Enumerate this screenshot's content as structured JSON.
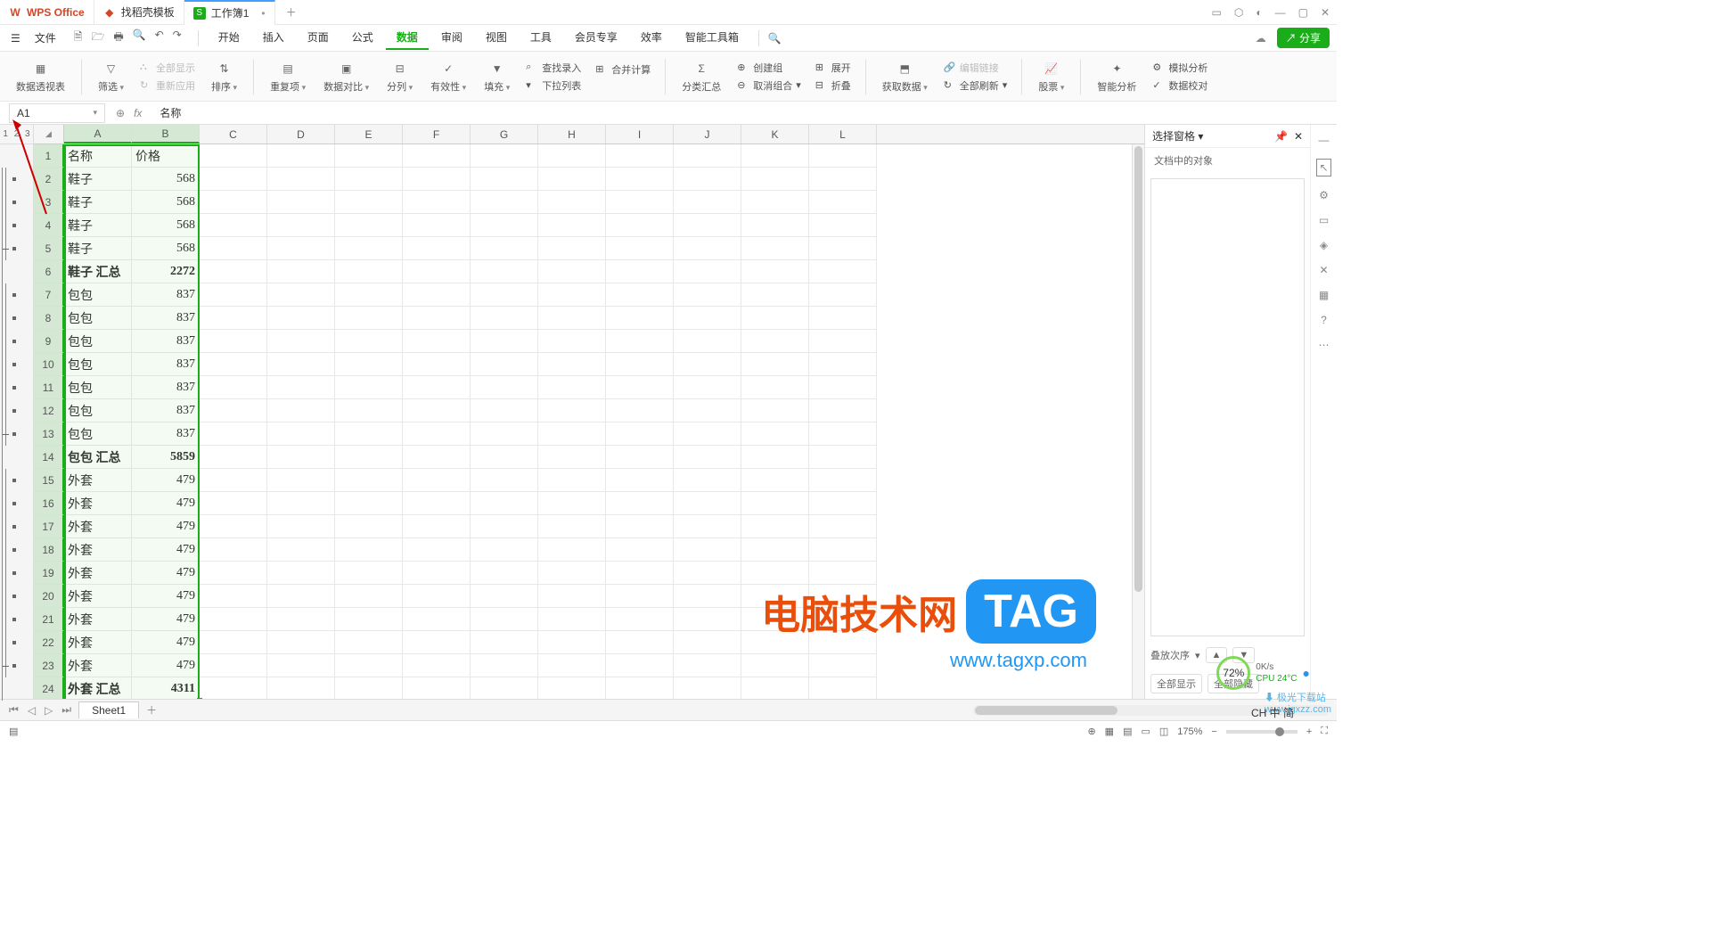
{
  "titlebar": {
    "wps": "WPS Office",
    "tab1": "找稻壳模板",
    "tab2": "工作簿1"
  },
  "menubar": {
    "file": "文件",
    "tabs": [
      "开始",
      "插入",
      "页面",
      "公式",
      "数据",
      "审阅",
      "视图",
      "工具",
      "会员专享",
      "效率",
      "智能工具箱"
    ],
    "active_index": 4,
    "share": "分享"
  },
  "ribbon": {
    "pivot": "数据透视表",
    "filter": "筛选",
    "show_all": "全部显示",
    "reapply": "重新应用",
    "sort": "排序",
    "dup": "重复项",
    "compare": "数据对比",
    "split": "分列",
    "valid": "有效性",
    "fill": "填充",
    "lookup": "查找录入",
    "consol": "合并计算",
    "dropdown": "下拉列表",
    "subtotal": "分类汇总",
    "group": "创建组",
    "ungroup": "取消组合",
    "expand": "展开",
    "collapse": "折叠",
    "getdata": "获取数据",
    "editlink": "编辑链接",
    "refresh": "全部刷新",
    "stock": "股票",
    "analysis": "智能分析",
    "whatif": "模拟分析",
    "datacheck": "数据校对"
  },
  "formulabar": {
    "namebox": "A1",
    "content": "名称"
  },
  "columns": [
    "A",
    "B",
    "C",
    "D",
    "E",
    "F",
    "G",
    "H",
    "I",
    "J",
    "K",
    "L"
  ],
  "outline_levels": [
    "1",
    "2",
    "3"
  ],
  "rows": [
    {
      "n": 1,
      "a": "名称",
      "b": "价格",
      "bold": false,
      "num": false
    },
    {
      "n": 2,
      "a": "鞋子",
      "b": "568",
      "num": true
    },
    {
      "n": 3,
      "a": "鞋子",
      "b": "568",
      "num": true
    },
    {
      "n": 4,
      "a": "鞋子",
      "b": "568",
      "num": true
    },
    {
      "n": 5,
      "a": "鞋子",
      "b": "568",
      "num": true
    },
    {
      "n": 6,
      "a": "鞋子  汇总",
      "b": "2272",
      "num": true,
      "bold": true
    },
    {
      "n": 7,
      "a": "包包",
      "b": "837",
      "num": true
    },
    {
      "n": 8,
      "a": "包包",
      "b": "837",
      "num": true
    },
    {
      "n": 9,
      "a": "包包",
      "b": "837",
      "num": true
    },
    {
      "n": 10,
      "a": "包包",
      "b": "837",
      "num": true
    },
    {
      "n": 11,
      "a": "包包",
      "b": "837",
      "num": true
    },
    {
      "n": 12,
      "a": "包包",
      "b": "837",
      "num": true
    },
    {
      "n": 13,
      "a": "包包",
      "b": "837",
      "num": true
    },
    {
      "n": 14,
      "a": "包包  汇总",
      "b": "5859",
      "num": true,
      "bold": true
    },
    {
      "n": 15,
      "a": "外套",
      "b": "479",
      "num": true
    },
    {
      "n": 16,
      "a": "外套",
      "b": "479",
      "num": true
    },
    {
      "n": 17,
      "a": "外套",
      "b": "479",
      "num": true
    },
    {
      "n": 18,
      "a": "外套",
      "b": "479",
      "num": true
    },
    {
      "n": 19,
      "a": "外套",
      "b": "479",
      "num": true
    },
    {
      "n": 20,
      "a": "外套",
      "b": "479",
      "num": true
    },
    {
      "n": 21,
      "a": "外套",
      "b": "479",
      "num": true
    },
    {
      "n": 22,
      "a": "外套",
      "b": "479",
      "num": true
    },
    {
      "n": 23,
      "a": "外套",
      "b": "479",
      "num": true
    },
    {
      "n": 24,
      "a": "外套  汇总",
      "b": "4311",
      "num": true,
      "bold": true
    }
  ],
  "rightpanel": {
    "title": "选择窗格",
    "sub": "文档中的对象",
    "stack": "叠放次序",
    "show_all": "全部显示",
    "hide_all": "全部隐藏"
  },
  "sheets": {
    "tab": "Sheet1"
  },
  "status": {
    "zoom": "175%",
    "cpu_pct": "72%",
    "net": "0K/s",
    "cpu_temp": "CPU 24°C",
    "ime": "CH 中 简",
    "dlsite": "极光下载站",
    "dlurl": "www.jgxzz.com"
  },
  "watermark": {
    "text": "电脑技术网",
    "tag": "TAG",
    "url": "www.tagxp.com"
  }
}
